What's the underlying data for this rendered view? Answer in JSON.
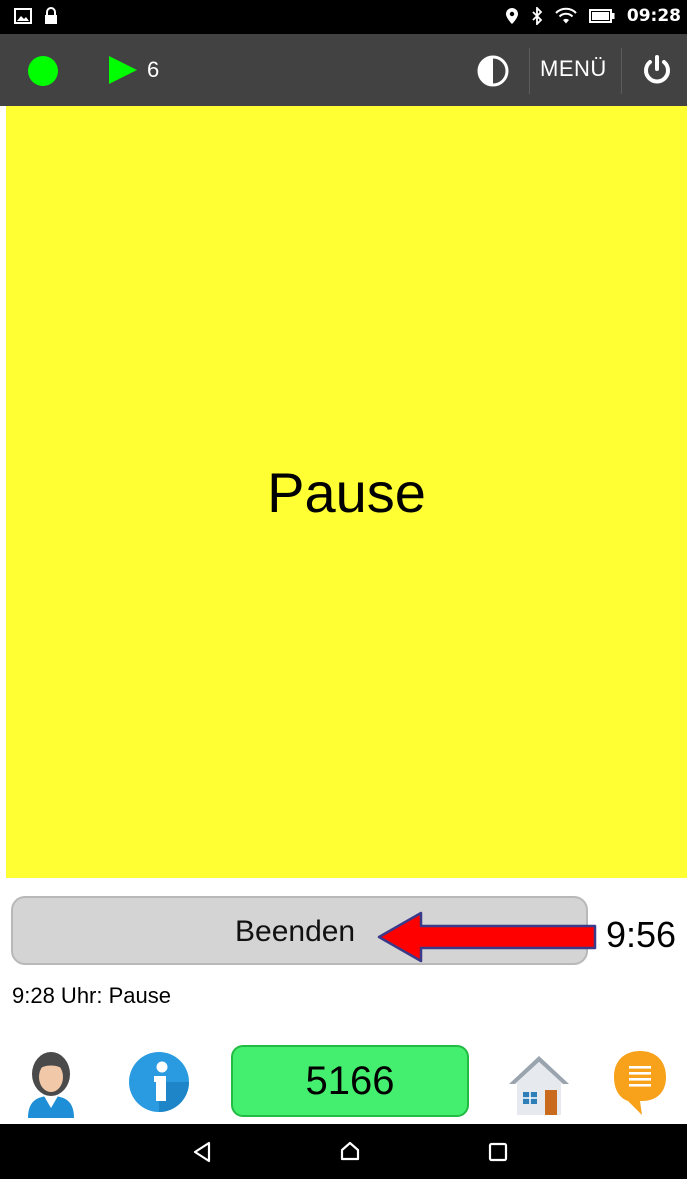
{
  "status_bar": {
    "time": "09:28",
    "left_icons": [
      "image-icon",
      "lock-icon"
    ],
    "right_icons": [
      "location-icon",
      "bluetooth-icon",
      "wifi-icon",
      "battery-icon"
    ]
  },
  "toolbar": {
    "status_color": "#00ff00",
    "play_count": "6",
    "menu_label": "MENÜ",
    "icons": [
      "status-dot-icon",
      "play-icon",
      "contrast-icon",
      "power-icon"
    ]
  },
  "main": {
    "label": "Pause",
    "background": "#ffff33"
  },
  "finish": {
    "label": "Beenden",
    "timer": "9:56",
    "arrow_color": "#ff0000"
  },
  "status_line": "9:28 Uhr: Pause",
  "bottom": {
    "code": "5166",
    "code_color": "#44ee6e",
    "icons": [
      "user-avatar-icon",
      "info-icon",
      "home-icon",
      "chat-icon"
    ]
  },
  "nav": {
    "icons": [
      "back-icon",
      "home-nav-icon",
      "recent-apps-icon"
    ]
  }
}
